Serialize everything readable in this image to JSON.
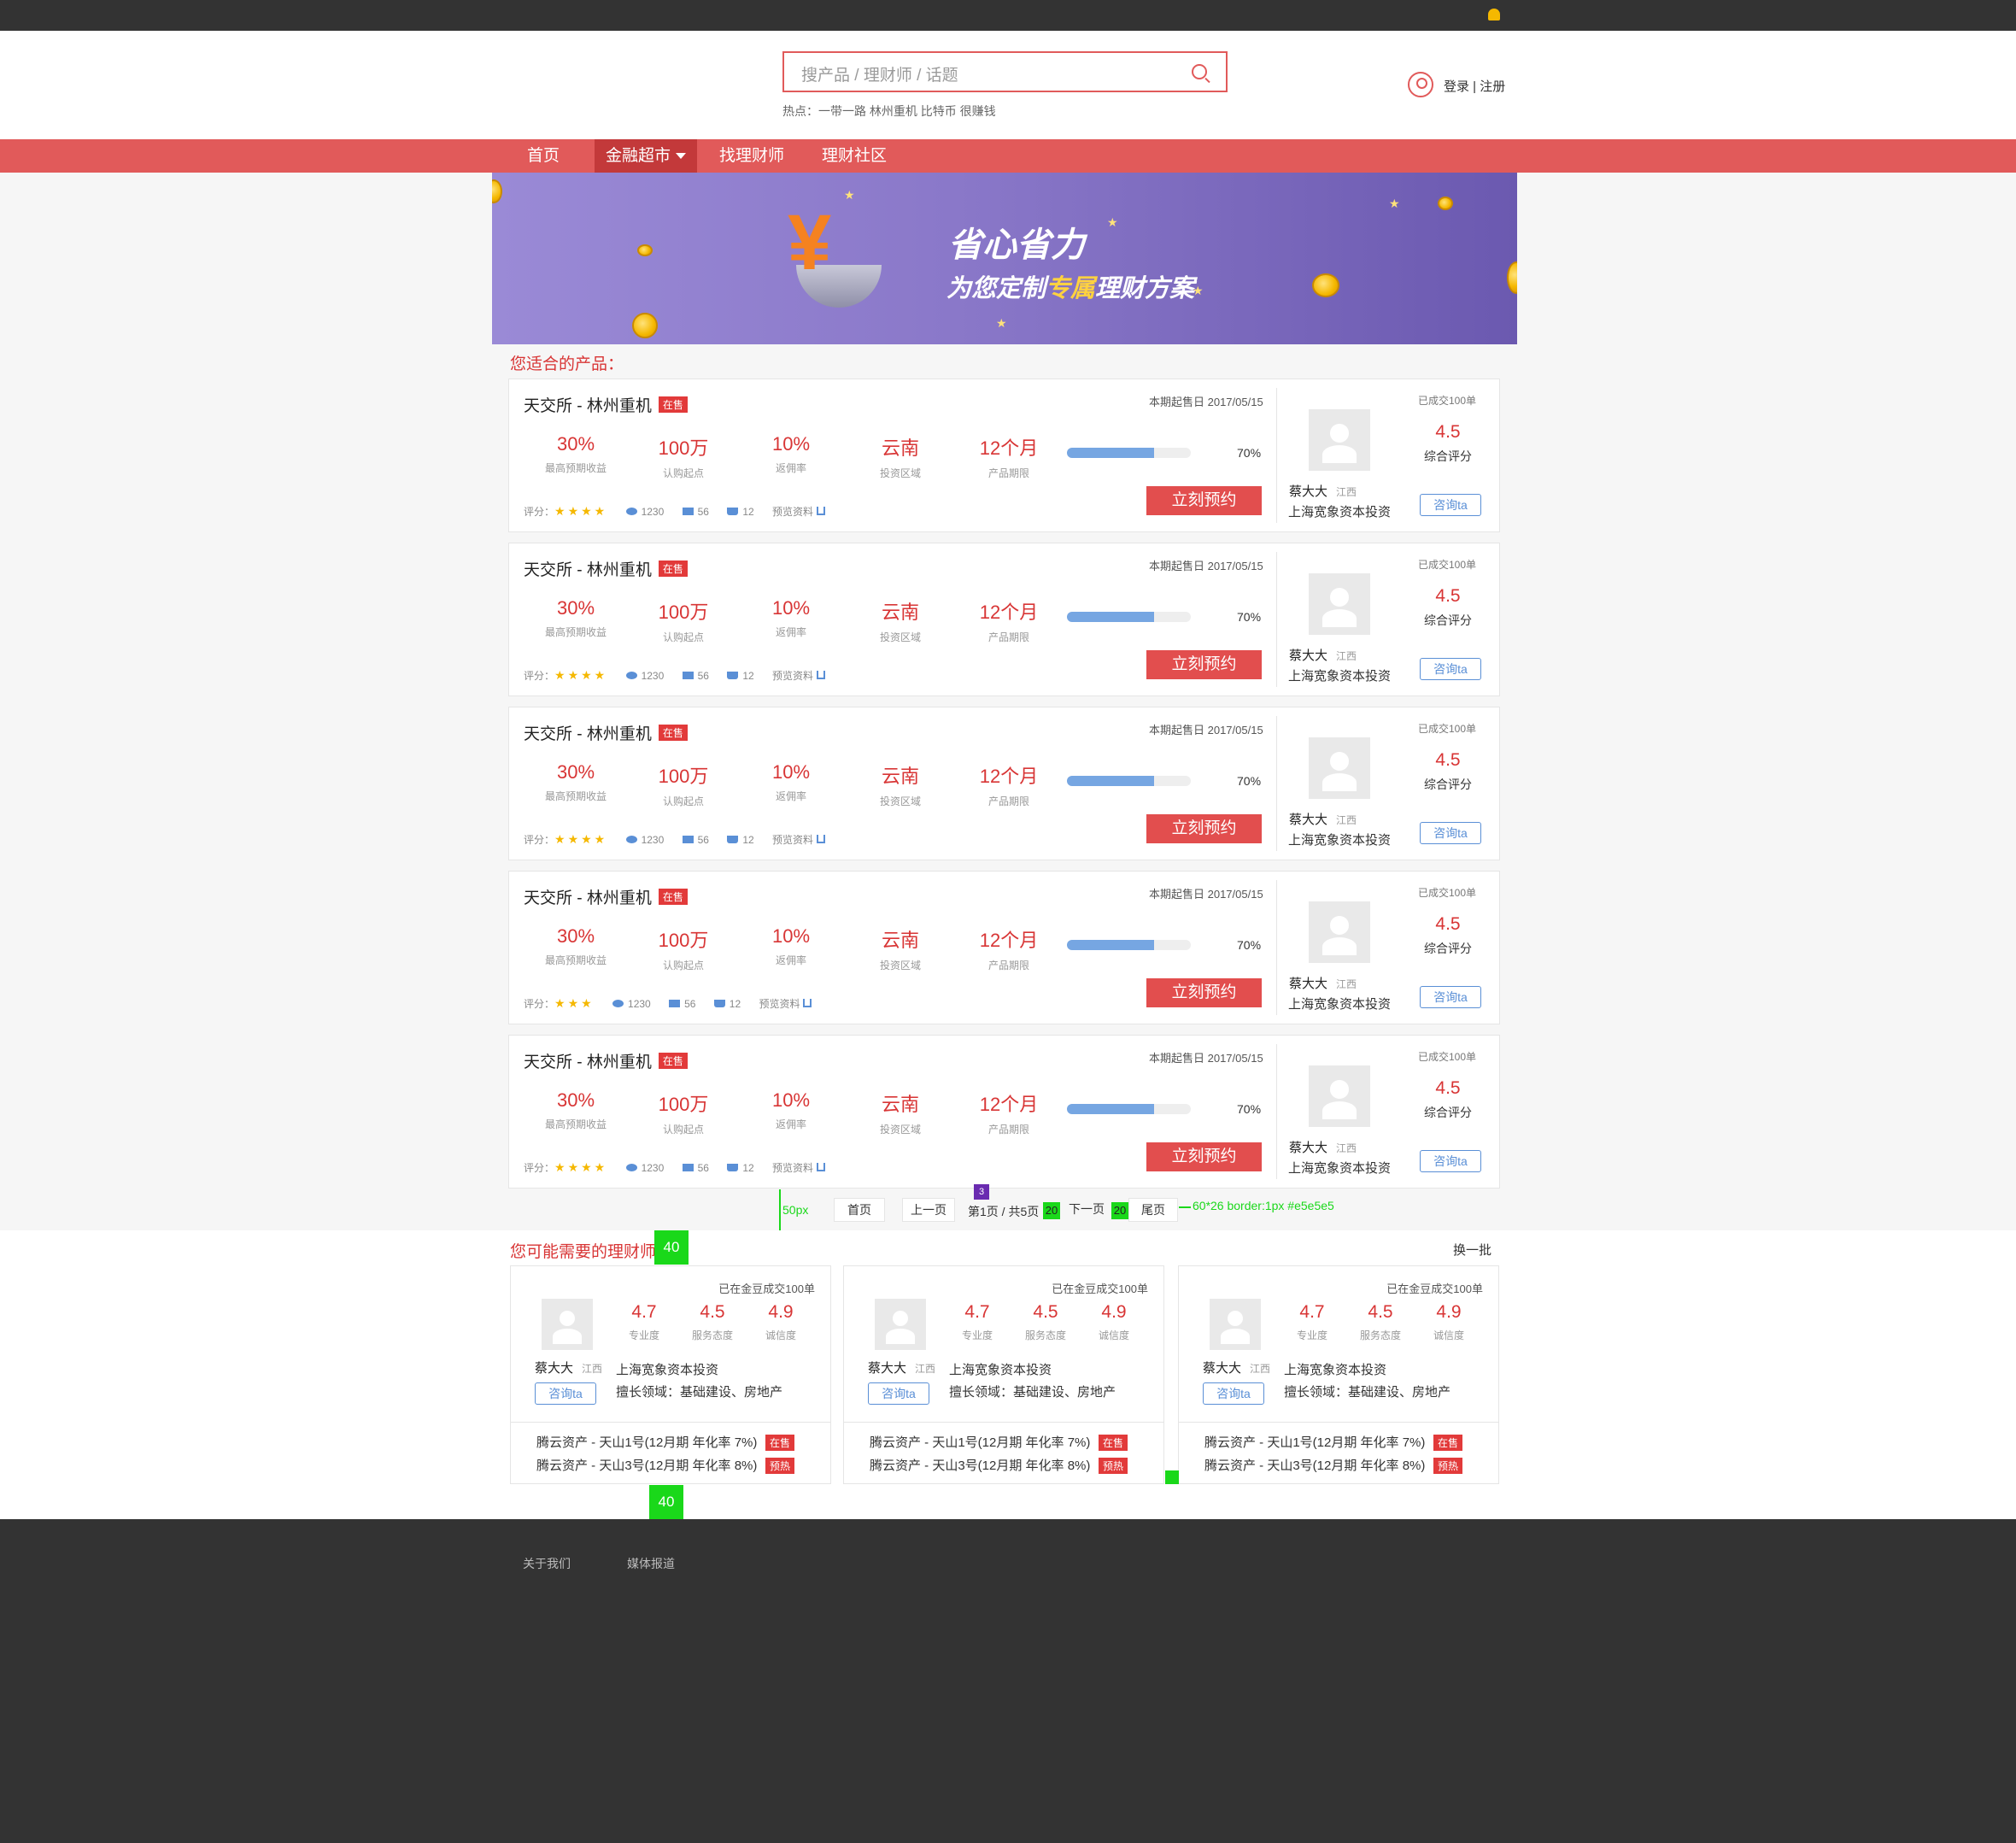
{
  "search": {
    "placeholder": "搜产品 / 理财师 / 话题"
  },
  "hot": "热点：一带一路 林州重机 比特币 很赚钱",
  "auth": "登录 | 注册",
  "nav": {
    "items": [
      "首页",
      "金融超市",
      "找理财师",
      "理财社区"
    ],
    "active": 1
  },
  "banner": {
    "title": "省心省力",
    "subtitle_pre": "为您定制",
    "subtitle_hl": "专属",
    "subtitle_post": "理财方案"
  },
  "section_products": "您适合的产品：",
  "products": [
    {
      "title": "天交所 - 林州重机",
      "tag": "在售",
      "sale_date": "本期起售日 2017/05/15",
      "stats": [
        {
          "v": "30%",
          "l": "最高预期收益"
        },
        {
          "v": "100万",
          "l": "认购起点"
        },
        {
          "v": "10%",
          "l": "返佣率"
        },
        {
          "v": "云南",
          "l": "投资区域"
        },
        {
          "v": "12个月",
          "l": "产品期限"
        }
      ],
      "progress": 0.7,
      "progress_label": "70%",
      "cta": "立刻预约",
      "rating_label": "评分：",
      "rating": 4,
      "views": "1230",
      "comments": "56",
      "cart": "12",
      "download": "预览资料",
      "deals": "已成交100单",
      "score": "4.5",
      "score_label": "综合评分",
      "advisor": "蔡大大",
      "province": "江西",
      "company": "上海宽象资本投资",
      "consult": "咨询ta"
    },
    {
      "title": "天交所 - 林州重机",
      "tag": "在售",
      "sale_date": "本期起售日 2017/05/15",
      "stats": [
        {
          "v": "30%",
          "l": "最高预期收益"
        },
        {
          "v": "100万",
          "l": "认购起点"
        },
        {
          "v": "10%",
          "l": "返佣率"
        },
        {
          "v": "云南",
          "l": "投资区域"
        },
        {
          "v": "12个月",
          "l": "产品期限"
        }
      ],
      "progress": 0.7,
      "progress_label": "70%",
      "cta": "立刻预约",
      "rating_label": "评分：",
      "rating": 4,
      "views": "1230",
      "comments": "56",
      "cart": "12",
      "download": "预览资料",
      "deals": "已成交100单",
      "score": "4.5",
      "score_label": "综合评分",
      "advisor": "蔡大大",
      "province": "江西",
      "company": "上海宽象资本投资",
      "consult": "咨询ta"
    },
    {
      "title": "天交所 - 林州重机",
      "tag": "在售",
      "sale_date": "本期起售日 2017/05/15",
      "stats": [
        {
          "v": "30%",
          "l": "最高预期收益"
        },
        {
          "v": "100万",
          "l": "认购起点"
        },
        {
          "v": "10%",
          "l": "返佣率"
        },
        {
          "v": "云南",
          "l": "投资区域"
        },
        {
          "v": "12个月",
          "l": "产品期限"
        }
      ],
      "progress": 0.7,
      "progress_label": "70%",
      "cta": "立刻预约",
      "rating_label": "评分：",
      "rating": 4,
      "views": "1230",
      "comments": "56",
      "cart": "12",
      "download": "预览资料",
      "deals": "已成交100单",
      "score": "4.5",
      "score_label": "综合评分",
      "advisor": "蔡大大",
      "province": "江西",
      "company": "上海宽象资本投资",
      "consult": "咨询ta"
    },
    {
      "title": "天交所 - 林州重机",
      "tag": "在售",
      "sale_date": "本期起售日 2017/05/15",
      "stats": [
        {
          "v": "30%",
          "l": "最高预期收益"
        },
        {
          "v": "100万",
          "l": "认购起点"
        },
        {
          "v": "10%",
          "l": "返佣率"
        },
        {
          "v": "云南",
          "l": "投资区域"
        },
        {
          "v": "12个月",
          "l": "产品期限"
        }
      ],
      "progress": 0.7,
      "progress_label": "70%",
      "cta": "立刻预约",
      "rating_label": "评分：",
      "rating": 3,
      "views": "1230",
      "comments": "56",
      "cart": "12",
      "download": "预览资料",
      "deals": "已成交100单",
      "score": "4.5",
      "score_label": "综合评分",
      "advisor": "蔡大大",
      "province": "江西",
      "company": "上海宽象资本投资",
      "consult": "咨询ta"
    },
    {
      "title": "天交所 - 林州重机",
      "tag": "在售",
      "sale_date": "本期起售日 2017/05/15",
      "stats": [
        {
          "v": "30%",
          "l": "最高预期收益"
        },
        {
          "v": "100万",
          "l": "认购起点"
        },
        {
          "v": "10%",
          "l": "返佣率"
        },
        {
          "v": "云南",
          "l": "投资区域"
        },
        {
          "v": "12个月",
          "l": "产品期限"
        }
      ],
      "progress": 0.7,
      "progress_label": "70%",
      "cta": "立刻预约",
      "rating_label": "评分：",
      "rating": 4,
      "views": "1230",
      "comments": "56",
      "cart": "12",
      "download": "预览资料",
      "deals": "已成交100单",
      "score": "4.5",
      "score_label": "综合评分",
      "advisor": "蔡大大",
      "province": "江西",
      "company": "上海宽象资本投资",
      "consult": "咨询ta"
    }
  ],
  "pagination": {
    "first": "首页",
    "prev": "上一页",
    "info": "第1页 / 共5页",
    "next": "下一页",
    "last": "尾页",
    "current_badge": "3"
  },
  "design_notes": {
    "spacing_50": "50px",
    "gap_20a": "20",
    "gap_20b": "20",
    "gap_40a": "40",
    "gap_40b": "40",
    "button_spec": "60*26 border:1px #e5e5e5"
  },
  "section_planners": "您可能需要的理财师",
  "refresh": "换一批",
  "planners": [
    {
      "deals": "已在金豆成交100单",
      "scores": [
        {
          "v": "4.7",
          "l": "专业度"
        },
        {
          "v": "4.5",
          "l": "服务态度"
        },
        {
          "v": "4.9",
          "l": "诚信度"
        }
      ],
      "name": "蔡大大",
      "province": "江西",
      "company": "上海宽象资本投资",
      "consult": "咨询ta",
      "specialty": "擅长领域：基础建设、房地产",
      "products": [
        {
          "name": "腾云资产 - 天山1号(12月期 年化率 7%)",
          "tag": "在售"
        },
        {
          "name": "腾云资产 - 天山3号(12月期 年化率 8%)",
          "tag": "预热"
        }
      ]
    },
    {
      "deals": "已在金豆成交100单",
      "scores": [
        {
          "v": "4.7",
          "l": "专业度"
        },
        {
          "v": "4.5",
          "l": "服务态度"
        },
        {
          "v": "4.9",
          "l": "诚信度"
        }
      ],
      "name": "蔡大大",
      "province": "江西",
      "company": "上海宽象资本投资",
      "consult": "咨询ta",
      "specialty": "擅长领域：基础建设、房地产",
      "products": [
        {
          "name": "腾云资产 - 天山1号(12月期 年化率 7%)",
          "tag": "在售"
        },
        {
          "name": "腾云资产 - 天山3号(12月期 年化率 8%)",
          "tag": "预热"
        }
      ]
    },
    {
      "deals": "已在金豆成交100单",
      "scores": [
        {
          "v": "4.7",
          "l": "专业度"
        },
        {
          "v": "4.5",
          "l": "服务态度"
        },
        {
          "v": "4.9",
          "l": "诚信度"
        }
      ],
      "name": "蔡大大",
      "province": "江西",
      "company": "上海宽象资本投资",
      "consult": "咨询ta",
      "specialty": "擅长领域：基础建设、房地产",
      "products": [
        {
          "name": "腾云资产 - 天山1号(12月期 年化率 7%)",
          "tag": "在售"
        },
        {
          "name": "腾云资产 - 天山3号(12月期 年化率 8%)",
          "tag": "预热"
        }
      ]
    }
  ],
  "footer": {
    "links": [
      "关于我们",
      "媒体报道"
    ]
  },
  "colors": {
    "brand": "#e15a5a",
    "nav_active": "#c3393a",
    "accent_red": "#d83535",
    "link_blue": "#5a8fd6",
    "annotation_green": "#1ad81a"
  },
  "icons": {
    "bell": "bell-icon",
    "search": "search-icon",
    "user": "user-icon",
    "eye": "eye-icon",
    "comment": "comment-icon",
    "cart": "cart-icon",
    "download": "download-icon"
  }
}
